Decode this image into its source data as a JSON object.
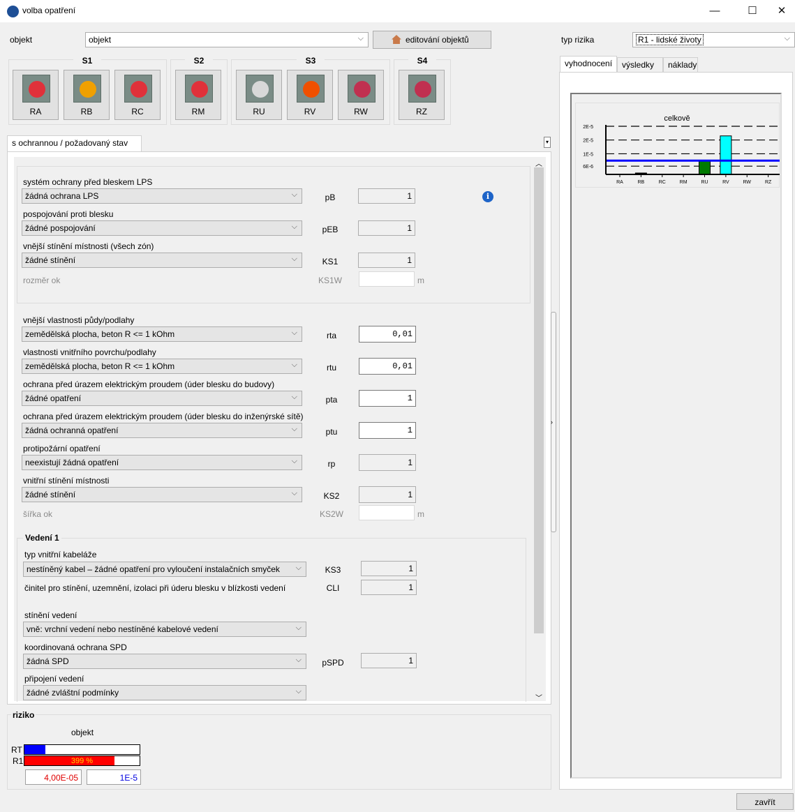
{
  "window": {
    "title": "volba opatření",
    "minimize": "—",
    "maximize": "☐",
    "close": "✕"
  },
  "objekt": {
    "label": "objekt",
    "value": "objekt",
    "edit_button": "editování objektů"
  },
  "risk_type": {
    "label": "typ rizika",
    "value": "R1 - lidské životy"
  },
  "groups": [
    {
      "label": "S1",
      "buttons": [
        "RA",
        "RB",
        "RC"
      ]
    },
    {
      "label": "S2",
      "buttons": [
        "RM"
      ]
    },
    {
      "label": "S3",
      "buttons": [
        "RU",
        "RV",
        "RW"
      ]
    },
    {
      "label": "S4",
      "buttons": [
        "RZ"
      ]
    }
  ],
  "left_tab": "s ochrannou / požadovaný stav",
  "form": {
    "g1": {
      "lps_label": "systém ochrany před bleskem LPS",
      "lps_value": "žádná ochrana LPS",
      "lps_param": "pB",
      "lps_num": "1",
      "eb_label": "pospojování proti blesku",
      "eb_value": "žádné pospojování",
      "eb_param": "pEB",
      "eb_num": "1",
      "ks1_label": "vnější stínění místnosti (všech zón)",
      "ks1_value": "žádné stínění",
      "ks1_param": "KS1",
      "ks1_num": "1",
      "ks1w_label": "rozměr ok",
      "ks1w_param": "KS1W",
      "ks1w_unit": "m"
    },
    "g2": {
      "rta_label": "vnější vlastnosti půdy/podlahy",
      "rta_value": "zemědělská plocha, beton  R <= 1 kOhm",
      "rta_param": "rta",
      "rta_num": "0,01",
      "rtu_label": "vlastnosti vnitřního povrchu/podlahy",
      "rtu_value": "zemědělská plocha, beton  R <= 1 kOhm",
      "rtu_param": "rtu",
      "rtu_num": "0,01",
      "pta_label": "ochrana před úrazem elektrickým proudem (úder blesku do budovy)",
      "pta_value": "žádné opatření",
      "pta_param": "pta",
      "pta_num": "1",
      "ptu_label": "ochrana před úrazem elektrickým proudem (úder blesku do inženýrské sítě)",
      "ptu_value": "žádná ochranná opatření",
      "ptu_param": "ptu",
      "ptu_num": "1",
      "rp_label": "protipožární opatření",
      "rp_value": "neexistují žádná opatření",
      "rp_param": "rp",
      "rp_num": "1",
      "ks2_label": "vnitřní stínění místnosti",
      "ks2_value": "žádné stínění",
      "ks2_param": "KS2",
      "ks2_num": "1",
      "ks2w_label": "šířka ok",
      "ks2w_param": "KS2W",
      "ks2w_unit": "m"
    },
    "vedeni": {
      "title": "Vedení 1",
      "ks3_label": "typ vnitřní kabeláže",
      "ks3_value": "nestíněný kabel – žádné opatření pro vyloučení instalačních smyček",
      "ks3_param": "KS3",
      "ks3_num": "1",
      "cli_label": "činitel pro stínění, uzemnění, izolaci při úderu blesku v blízkosti vedení",
      "cli_param": "CLI",
      "cli_num": "1",
      "st_label": "stínění vedení",
      "st_value": "vně: vrchní vedení nebo nestíněné kabelové vedení",
      "spd_label": "koordinovaná ochrana SPD",
      "spd_value": "žádná SPD",
      "spd_param": "pSPD",
      "spd_num": "1",
      "pv_label": "připojení vedení",
      "pv_value": "žádné zvláštní podmínky"
    }
  },
  "riziko": {
    "title": "riziko",
    "column": "objekt",
    "rows": [
      {
        "label": "RT",
        "fill": 0.18,
        "color": "#0000ff"
      },
      {
        "label": "R1",
        "fill": 0.78,
        "color": "#ff0000",
        "percent": "399 %"
      }
    ],
    "value": "4,00E-05",
    "limit": "1E-5"
  },
  "right_tabs": [
    "vyhodnocení",
    "výsledky",
    "náklady"
  ],
  "chart_data": {
    "type": "bar",
    "title": "celkově",
    "categories": [
      "RA",
      "RB",
      "RC",
      "RM",
      "RU",
      "RV",
      "RW",
      "RZ"
    ],
    "values": [
      0,
      1.2e-07,
      0,
      0,
      1e-05,
      2.8e-05,
      0,
      0
    ],
    "ylim": [
      0,
      3.6e-05
    ],
    "yticks": [
      {
        "label": "2E-5",
        "value": 3.5e-05
      },
      {
        "label": "2E-5",
        "value": 2.5e-05
      },
      {
        "label": "1E-5",
        "value": 1.5e-05
      },
      {
        "label": "6E-6",
        "value": 6e-06
      }
    ],
    "limit": 1e-05,
    "colors": [
      "#000000",
      "#000000",
      "#000000",
      "#000000",
      "#007a00",
      "#00ffff",
      "#000000",
      "#000000"
    ]
  },
  "close_button": "zavřít",
  "colors": {
    "info": "#1e64c8",
    "limit_line": "#0000ff"
  }
}
